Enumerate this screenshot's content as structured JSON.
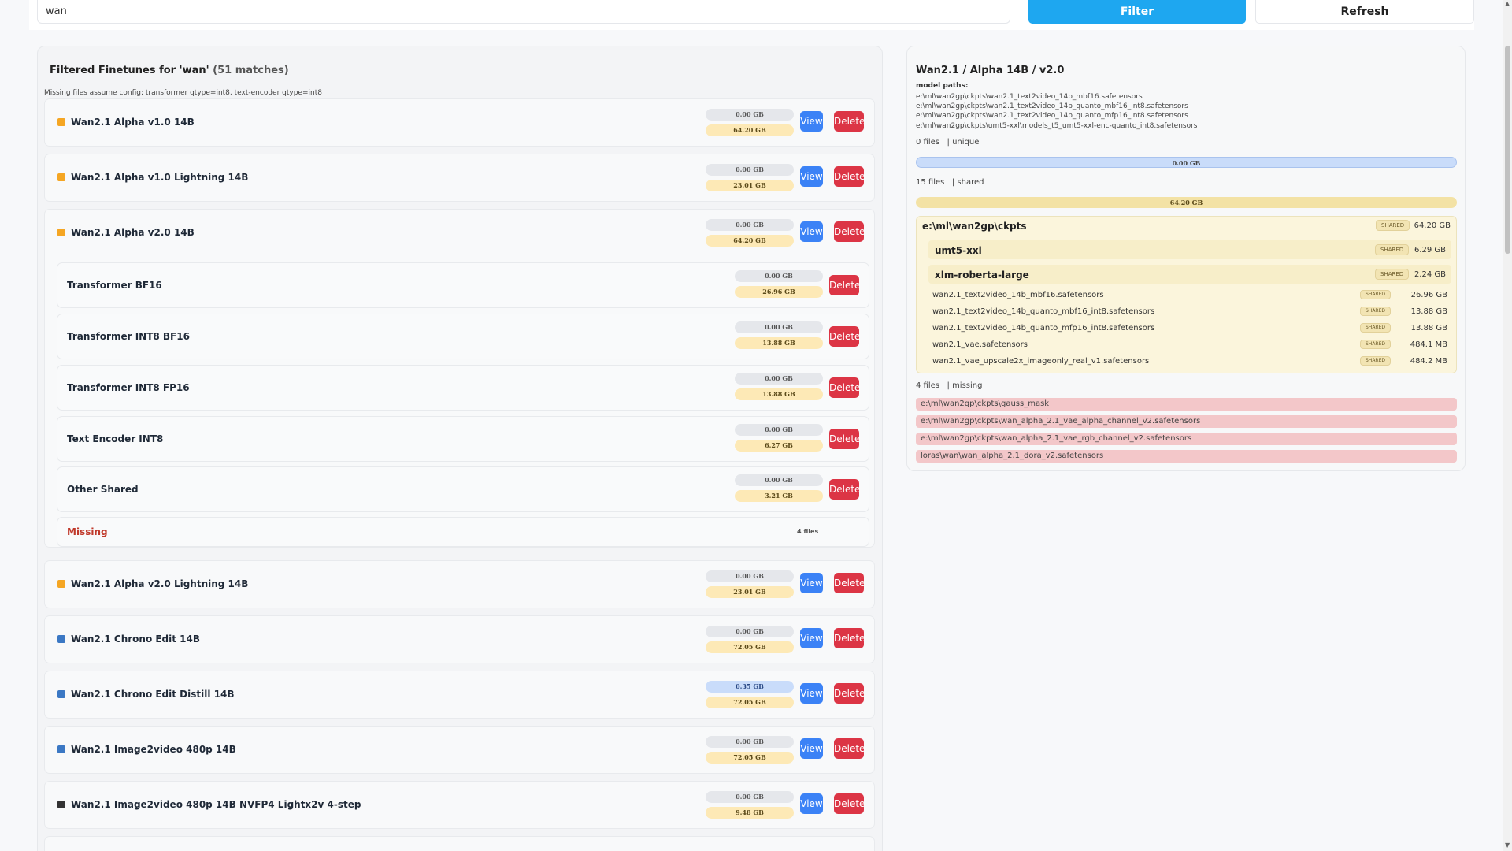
{
  "toolbar": {
    "search_value": "wan",
    "filter_label": "Filter",
    "refresh_label": "Refresh"
  },
  "left": {
    "title": "Filtered Finetunes for 'wan'",
    "match_count": "(51 matches)",
    "config_note": "Missing files assume config: transformer qtype=int8, text-encoder qtype=int8",
    "view_label": "View",
    "delete_label": "Delete",
    "rows": [
      {
        "name": "Wan2.1 Alpha v1.0 14B",
        "unique": "0.00 GB",
        "shared": "64.20 GB",
        "color": "#f5a623"
      },
      {
        "name": "Wan2.1 Alpha v1.0 Lightning 14B",
        "unique": "0.00 GB",
        "shared": "23.01 GB",
        "color": "#f5a623"
      },
      {
        "name": "Wan2.1 Alpha v2.0 14B",
        "unique": "0.00 GB",
        "shared": "64.20 GB",
        "color": "#f5a623"
      },
      {
        "name": "Wan2.1 Alpha v2.0 Lightning 14B",
        "unique": "0.00 GB",
        "shared": "23.01 GB",
        "color": "#f5a623"
      },
      {
        "name": "Wan2.1 Chrono Edit 14B",
        "unique": "0.00 GB",
        "shared": "72.05 GB",
        "color": "#3b78c4"
      },
      {
        "name": "Wan2.1 Chrono Edit Distill 14B",
        "unique": "0.35 GB",
        "shared": "72.05 GB",
        "color": "#3b78c4"
      },
      {
        "name": "Wan2.1 Image2video 480p 14B",
        "unique": "0.00 GB",
        "shared": "72.05 GB",
        "color": "#3b78c4"
      },
      {
        "name": "Wan2.1 Image2video 480p 14B NVFP4 Lightx2v 4-step",
        "unique": "0.00 GB",
        "shared": "9.48 GB",
        "color": "#333333"
      }
    ],
    "sub_rows": [
      {
        "name": "Transformer BF16",
        "unique": "0.00 GB",
        "shared": "26.96 GB"
      },
      {
        "name": "Transformer INT8 BF16",
        "unique": "0.00 GB",
        "shared": "13.88 GB"
      },
      {
        "name": "Transformer INT8 FP16",
        "unique": "0.00 GB",
        "shared": "13.88 GB"
      },
      {
        "name": "Text Encoder INT8",
        "unique": "0.00 GB",
        "shared": "6.27 GB"
      },
      {
        "name": "Other Shared",
        "unique": "0.00 GB",
        "shared": "3.21 GB"
      }
    ],
    "missing_label": "Missing",
    "missing_files": "4 files"
  },
  "right": {
    "title": "Wan2.1 / Alpha 14B / v2.0",
    "paths_label": "model paths:",
    "paths": [
      "e:\\ml\\wan2gp\\ckpts\\wan2.1_text2video_14b_mbf16.safetensors",
      "e:\\ml\\wan2gp\\ckpts\\wan2.1_text2video_14b_quanto_mbf16_int8.safetensors",
      "e:\\ml\\wan2gp\\ckpts\\wan2.1_text2video_14b_quanto_mfp16_int8.safetensors",
      "e:\\ml\\wan2gp\\ckpts\\umt5-xxl\\models_t5_umt5-xxl-enc-quanto_int8.safetensors"
    ],
    "unique_summary": "0 files   | unique",
    "unique_bar": "0.00 GB",
    "shared_summary": "15 files   | shared",
    "shared_bar": "64.20 GB",
    "shared_tag": "SHARED",
    "root_dir": {
      "name": "e:\\ml\\wan2gp\\ckpts",
      "size": "64.20 GB"
    },
    "sub_dirs": [
      {
        "name": "umt5-xxl",
        "size": "6.29 GB"
      },
      {
        "name": "xlm-roberta-large",
        "size": "2.24 GB"
      }
    ],
    "files": [
      {
        "name": "wan2.1_text2video_14b_mbf16.safetensors",
        "size": "26.96 GB"
      },
      {
        "name": "wan2.1_text2video_14b_quanto_mbf16_int8.safetensors",
        "size": "13.88 GB"
      },
      {
        "name": "wan2.1_text2video_14b_quanto_mfp16_int8.safetensors",
        "size": "13.88 GB"
      },
      {
        "name": "wan2.1_vae.safetensors",
        "size": "484.1 MB"
      },
      {
        "name": "wan2.1_vae_upscale2x_imageonly_real_v1.safetensors",
        "size": "484.2 MB"
      }
    ],
    "missing_summary": "4 files   | missing",
    "missing": [
      "e:\\ml\\wan2gp\\ckpts\\gauss_mask",
      "e:\\ml\\wan2gp\\ckpts\\wan_alpha_2.1_vae_alpha_channel_v2.safetensors",
      "e:\\ml\\wan2gp\\ckpts\\wan_alpha_2.1_vae_rgb_channel_v2.safetensors",
      "loras\\wan\\wan_alpha_2.1_dora_v2.safetensors"
    ]
  }
}
